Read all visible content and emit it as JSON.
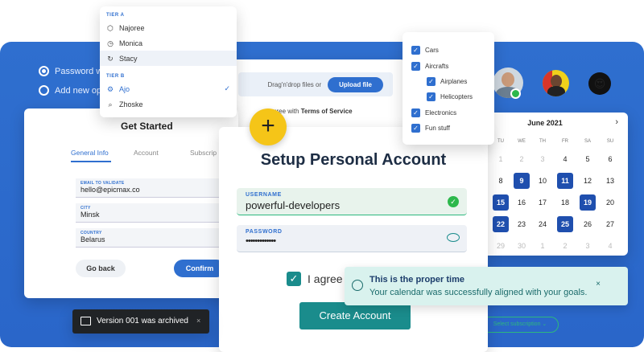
{
  "radio": {
    "opt1": "Password was",
    "opt2": "Add new optio"
  },
  "tier": {
    "a_label": "TIER A",
    "a_items": [
      "Najoree",
      "Monica",
      "Stacy"
    ],
    "b_label": "TIER B",
    "b_items": [
      "Ajo",
      "Zhoske"
    ]
  },
  "upload": {
    "drop_text": "Drag'n'drop files or",
    "button": "Upload file",
    "terms_prefix": "gree with",
    "terms_link": "Terms of Service"
  },
  "tree": [
    "Cars",
    "Aircrafts",
    "Airplanes",
    "Helicopters",
    "Electronics",
    "Fun stuff"
  ],
  "calendar": {
    "month": "June 2021",
    "next": "›",
    "days": [
      "TU",
      "WE",
      "TH",
      "FR",
      "SA",
      "SU"
    ],
    "rows": [
      [
        "1",
        "2",
        "3",
        "4",
        "5",
        "6"
      ],
      [
        "8",
        "9",
        "10",
        "11",
        "12",
        "13"
      ],
      [
        "15",
        "16",
        "17",
        "18",
        "19",
        "20"
      ],
      [
        "22",
        "23",
        "24",
        "25",
        "26",
        "27"
      ],
      [
        "29",
        "30",
        "1",
        "2",
        "3",
        "4"
      ]
    ]
  },
  "get_started": {
    "title": "Get Started",
    "tabs": [
      "General Info",
      "Account",
      "Subscrip"
    ],
    "fields": [
      {
        "label": "EMAIL TO VALIDATE",
        "value": "hello@epicmax.co"
      },
      {
        "label": "CITY",
        "value": "Minsk"
      },
      {
        "label": "COUNTRY",
        "value": "Belarus"
      }
    ],
    "back": "Go back",
    "confirm": "Confirm"
  },
  "setup": {
    "title": "Setup Personal Account",
    "username_label": "USERNAME",
    "username": "powerful-developers",
    "password_label": "PASSWORD",
    "password": "•••••••••••••",
    "agree": "I agree t",
    "create": "Create Account"
  },
  "plus": "+",
  "toast": {
    "title": "This is the proper time",
    "message": "Your calendar was successfully aligned with your goals.",
    "close": "×"
  },
  "archived": {
    "text": "Version 001 was archived",
    "close": "×"
  },
  "subscription_button": "Select subscription  ⌄",
  "colors": {
    "primary": "#2f6fcf",
    "teal": "#1a8c8c",
    "yellow": "#f5c518",
    "success": "#2db87e"
  }
}
